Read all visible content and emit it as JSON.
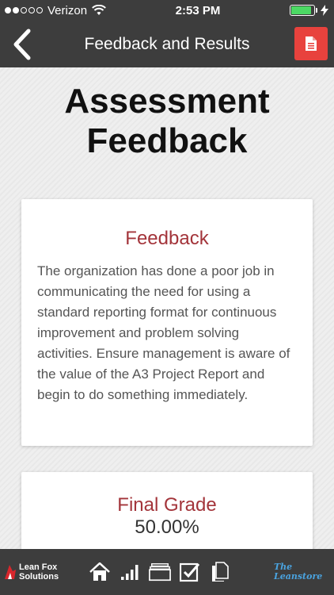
{
  "status": {
    "carrier": "Verizon",
    "time": "2:53 PM",
    "signal_bars_filled": 2,
    "signal_bars_total": 5,
    "battery_level": 0.9
  },
  "header": {
    "title": "Feedback and Results",
    "accent": "#e8423d"
  },
  "main": {
    "title": "Assessment Feedback",
    "feedback": {
      "heading": "Feedback",
      "text": "The organization has done a poor job in communicating the need for using a standard reporting format for continuous improvement and problem solving activities. Ensure management is aware of the value of the A3 Project Report and begin to do something immediately."
    },
    "grade": {
      "heading": "Final Grade",
      "value": "50.00%"
    }
  },
  "footer": {
    "logo_left": "Lean Fox Solutions",
    "logo_right": "The Leanstore",
    "icons": [
      "home-icon",
      "chart-icon",
      "folder-icon",
      "checkbox-icon",
      "documents-icon"
    ]
  }
}
